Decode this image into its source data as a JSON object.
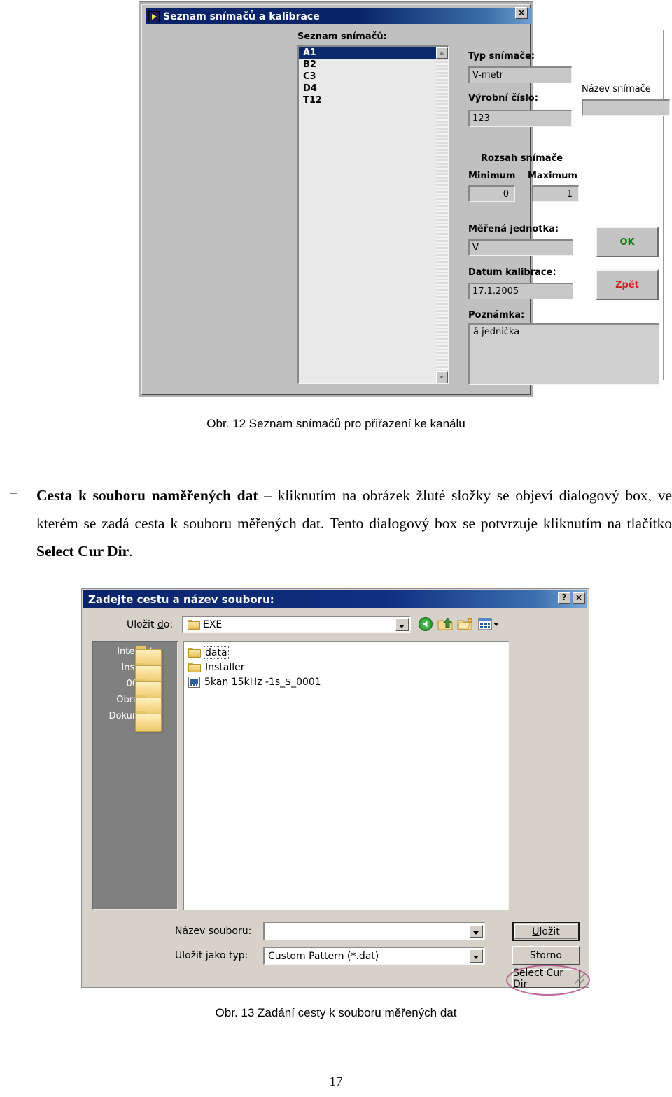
{
  "figure12": {
    "window": {
      "title": "Seznam snímačů a kalibrace",
      "close_label": "×",
      "icon": "labview-vi-icon"
    },
    "list": {
      "label": "Seznam snímačů:",
      "items": [
        "A1",
        "B2",
        "C3",
        "D4",
        "T12"
      ],
      "selected": "A1",
      "scroll_up": "▲",
      "scroll_down": "▼"
    },
    "fields": {
      "type_label": "Typ snímače:",
      "type_value": "V-metr",
      "serial_label": "Výrobní číslo:",
      "serial_value": "123",
      "name_label": "Název snímače",
      "name_value": "",
      "range_title": "Rozsah snímače",
      "min_label": "Minimum",
      "min_value": "0",
      "max_label": "Maximum",
      "max_value": "1",
      "unit_label": "Měřená jednotka:",
      "unit_value": "V",
      "caldate_label": "Datum kalibrace:",
      "caldate_value": "17.1.2005",
      "note_label": "Poznámka:",
      "note_value": "á jednička"
    },
    "buttons": {
      "ok": "OK",
      "back": "Zpět"
    },
    "colors": {
      "ok_text": "#0b7a0b",
      "back_text": "#cc2222",
      "titlebar": "#0a246a",
      "face": "#c0c0c0",
      "selection": "#0b2a6b"
    }
  },
  "caption12": "Obr. 12 Seznam snímačů pro přiřazení ke kanálu",
  "paragraph": {
    "dash": "–",
    "bold_lead": "Cesta k souboru naměřených dat",
    "rest_1": " – kliknutím na obrázek žluté složky se objeví dialogový box, ve kterém se zadá cesta k souboru měřených dat. Tento dialogový box se potvrzuje kliknutím na tlačítko ",
    "bold_tail": "Select Cur Dir",
    "rest_2": "."
  },
  "figure13": {
    "window": {
      "title": "Zadejte cestu a název souboru:",
      "help_label": "?",
      "close_label": "×"
    },
    "savein": {
      "label_prefix": "Uložit ",
      "label_underline": "d",
      "label_suffix": "o:",
      "value": "EXE",
      "folder_icon": "folder-icon",
      "dropdown_icon": "chevron-down-icon"
    },
    "toolbar": [
      {
        "name": "back-icon",
        "label": "Zpět"
      },
      {
        "name": "up-one-level-icon",
        "label": "O úroveň výš"
      },
      {
        "name": "new-folder-icon",
        "label": "Vytvořit novou složku"
      },
      {
        "name": "views-icon",
        "label": "Zobrazení"
      }
    ],
    "places": [
      {
        "label": "Internet",
        "icon": "folder-icon"
      },
      {
        "label": "Install",
        "icon": "folder-icon"
      },
      {
        "label": "000",
        "icon": "folder-icon"
      },
      {
        "label": "Obrázky",
        "icon": "folder-icon"
      },
      {
        "label": "Dokumenty",
        "icon": "folder-icon"
      }
    ],
    "files": [
      {
        "name": "data",
        "type": "folder",
        "focused": true
      },
      {
        "name": "Installer",
        "type": "folder",
        "focused": false
      },
      {
        "name": "5kan 15kHz -1s_$_0001",
        "type": "file",
        "focused": false
      }
    ],
    "filename": {
      "label_prefix": "",
      "label_underline": "N",
      "label_suffix": "ázev souboru:",
      "value": "",
      "dropdown_icon": "chevron-down-icon"
    },
    "filetype": {
      "label_prefix": "Uložit ",
      "label_underline": "j",
      "label_suffix": "ako typ:",
      "value": "Custom Pattern (*.dat)",
      "dropdown_icon": "chevron-down-icon"
    },
    "buttons": {
      "save_prefix": "",
      "save_underline": "U",
      "save_suffix": "ložit",
      "cancel": "Storno",
      "select_cur_dir": "Select Cur Dir"
    },
    "colors": {
      "places_bg": "#808080",
      "titlebar": "#0a246a",
      "face": "#d6d2ca",
      "highlight_ellipse": "#b4508a"
    }
  },
  "caption13": "Obr. 13 Zadání cesty k souboru měřených dat",
  "page_number": "17"
}
